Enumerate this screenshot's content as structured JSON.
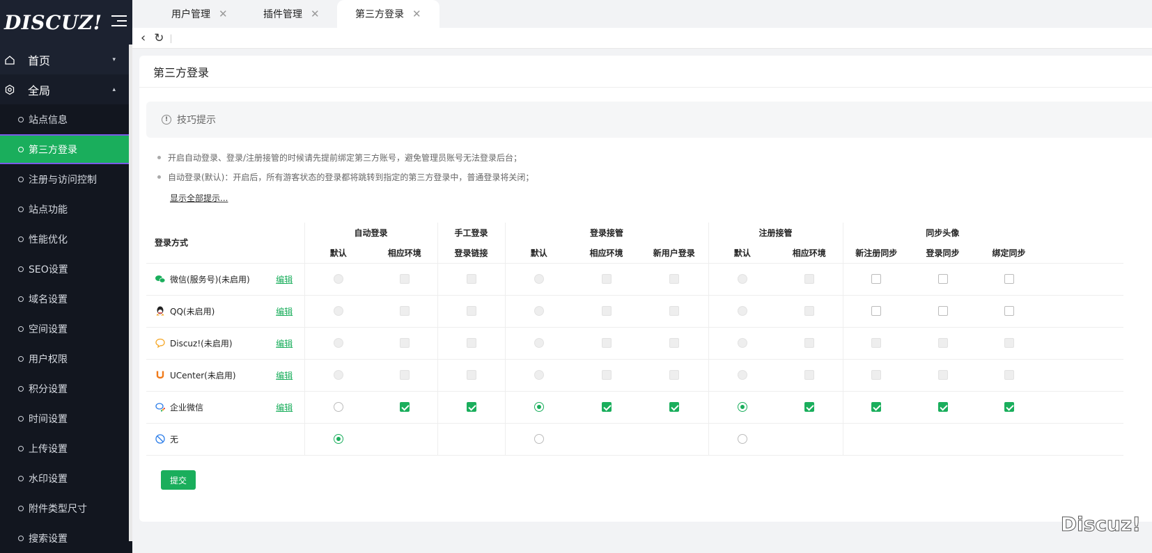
{
  "sidebar": {
    "logo": "DISCUZ!",
    "top_items": [
      {
        "label": "首页",
        "icon": "home-icon",
        "caret": "▾"
      },
      {
        "label": "全局",
        "icon": "gear-icon",
        "caret": "▴"
      }
    ],
    "items": [
      {
        "label": "站点信息"
      },
      {
        "label": "第三方登录"
      },
      {
        "label": "注册与访问控制"
      },
      {
        "label": "站点功能"
      },
      {
        "label": "性能优化"
      },
      {
        "label": "SEO设置"
      },
      {
        "label": "域名设置"
      },
      {
        "label": "空间设置"
      },
      {
        "label": "用户权限"
      },
      {
        "label": "积分设置"
      },
      {
        "label": "时间设置"
      },
      {
        "label": "上传设置"
      },
      {
        "label": "水印设置"
      },
      {
        "label": "附件类型尺寸"
      },
      {
        "label": "搜索设置"
      }
    ]
  },
  "tabs": [
    {
      "label": "用户管理"
    },
    {
      "label": "插件管理"
    },
    {
      "label": "第三方登录"
    }
  ],
  "page": {
    "title": "第三方登录",
    "tip_title": "技巧提示",
    "tips": [
      "开启自动登录、登录/注册接管的时候请先提前绑定第三方账号，避免管理员账号无法登录后台；",
      "自动登录(默认)：开启后，所有游客状态的登录都将跳转到指定的第三方登录中，普通登录将关闭；"
    ],
    "show_all": "显示全部提示...",
    "submit": "提交",
    "watermark": "Discuz!"
  },
  "table": {
    "first_col": "登录方式",
    "groups": [
      "自动登录",
      "手工登录",
      "登录接管",
      "注册接管",
      "同步头像"
    ],
    "columns": [
      "默认",
      "相应环境",
      "登录链接",
      "默认",
      "相应环境",
      "新用户登录",
      "默认",
      "相应环境",
      "新注册同步",
      "登录同步",
      "绑定同步"
    ],
    "edit_label": "编辑",
    "rows": [
      {
        "name": "微信(服务号)(未启用)",
        "icon": "wechat-icon"
      },
      {
        "name": "QQ(未启用)",
        "icon": "qq-icon"
      },
      {
        "name": "Discuz!(未启用)",
        "icon": "discuz-icon"
      },
      {
        "name": "UCenter(未启用)",
        "icon": "ucenter-icon"
      },
      {
        "name": "企业微信",
        "icon": "wecom-icon"
      },
      {
        "name": "无",
        "icon": "none-icon"
      }
    ]
  },
  "colors": {
    "accent": "#1aae5c",
    "sidebar": "#1c2230"
  }
}
